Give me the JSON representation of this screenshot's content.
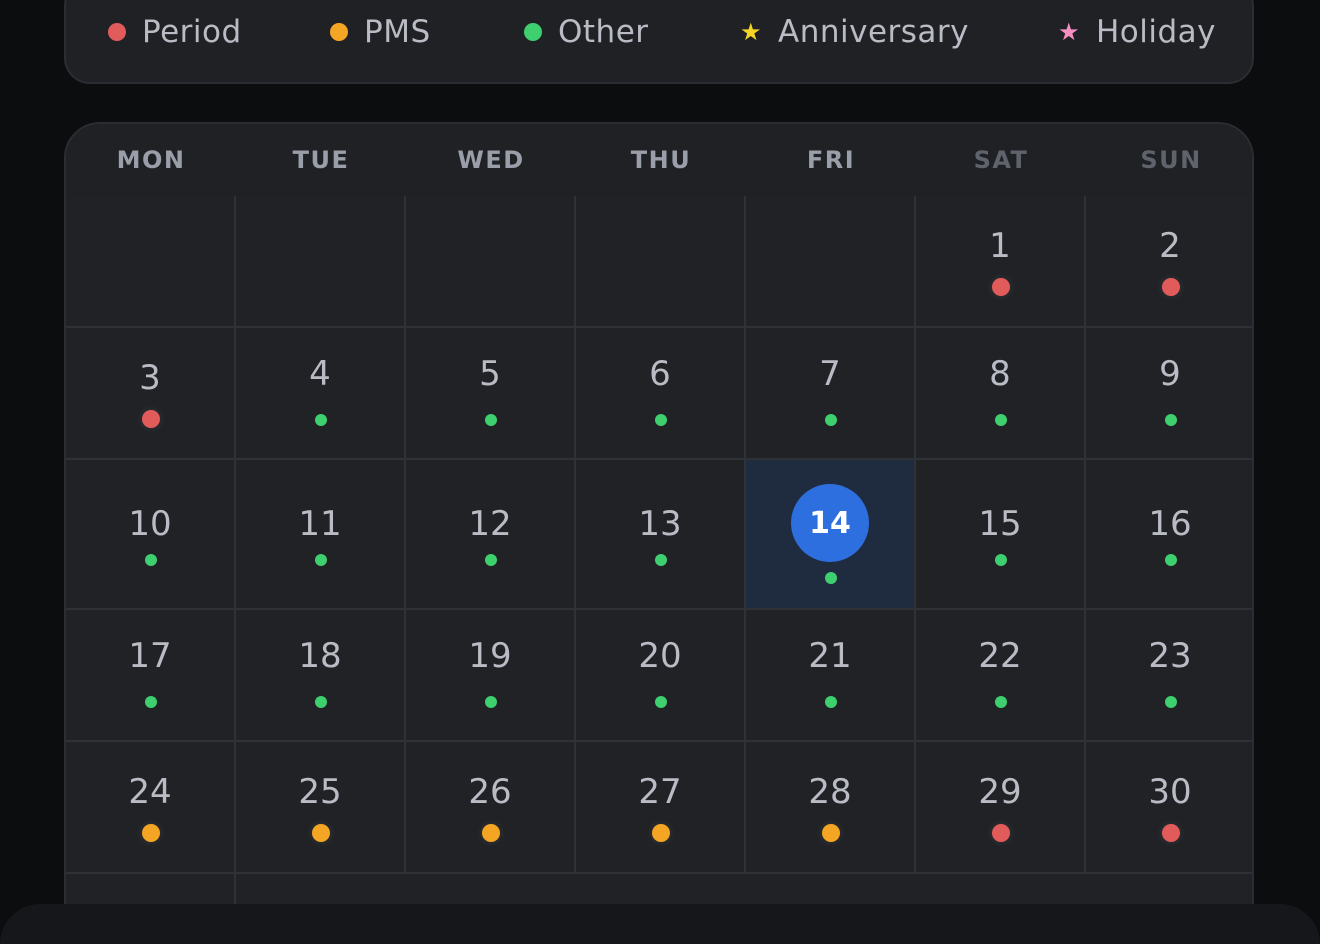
{
  "legend": [
    {
      "label": "Period",
      "kind": "dot",
      "color": "#e25b5b",
      "icon": "period-dot-icon"
    },
    {
      "label": "PMS",
      "kind": "dot",
      "color": "#f5a524",
      "icon": "pms-dot-icon"
    },
    {
      "label": "Other",
      "kind": "dot",
      "color": "#3ecf6e",
      "icon": "other-dot-icon"
    },
    {
      "label": "Anniversary",
      "kind": "star",
      "color": "#f5d426",
      "icon": "star-icon"
    },
    {
      "label": "Holiday",
      "kind": "star",
      "color": "#f58fc0",
      "icon": "star-icon"
    }
  ],
  "weekdays": [
    {
      "label": "MON",
      "weekend": false
    },
    {
      "label": "TUE",
      "weekend": false
    },
    {
      "label": "WED",
      "weekend": false
    },
    {
      "label": "THU",
      "weekend": false
    },
    {
      "label": "FRI",
      "weekend": false
    },
    {
      "label": "SAT",
      "weekend": true
    },
    {
      "label": "SUN",
      "weekend": true
    }
  ],
  "today": 14,
  "days": [
    {
      "day": 1,
      "type": "period"
    },
    {
      "day": 2,
      "type": "period"
    },
    {
      "day": 3,
      "type": "period"
    },
    {
      "day": 4,
      "type": "other"
    },
    {
      "day": 5,
      "type": "other"
    },
    {
      "day": 6,
      "type": "other"
    },
    {
      "day": 7,
      "type": "other"
    },
    {
      "day": 8,
      "type": "other"
    },
    {
      "day": 9,
      "type": "other"
    },
    {
      "day": 10,
      "type": "other"
    },
    {
      "day": 11,
      "type": "other"
    },
    {
      "day": 12,
      "type": "other"
    },
    {
      "day": 13,
      "type": "other"
    },
    {
      "day": 14,
      "type": "other"
    },
    {
      "day": 15,
      "type": "other"
    },
    {
      "day": 16,
      "type": "other"
    },
    {
      "day": 17,
      "type": "other"
    },
    {
      "day": 18,
      "type": "other"
    },
    {
      "day": 19,
      "type": "other"
    },
    {
      "day": 20,
      "type": "other"
    },
    {
      "day": 21,
      "type": "other"
    },
    {
      "day": 22,
      "type": "other"
    },
    {
      "day": 23,
      "type": "other"
    },
    {
      "day": 24,
      "type": "pms"
    },
    {
      "day": 25,
      "type": "pms"
    },
    {
      "day": 26,
      "type": "pms"
    },
    {
      "day": 27,
      "type": "pms"
    },
    {
      "day": 28,
      "type": "pms"
    },
    {
      "day": 29,
      "type": "period"
    },
    {
      "day": 30,
      "type": "period"
    }
  ],
  "type_colors": {
    "period": "#e25b5b",
    "pms": "#f5a524",
    "other": "#3ecf6e"
  }
}
